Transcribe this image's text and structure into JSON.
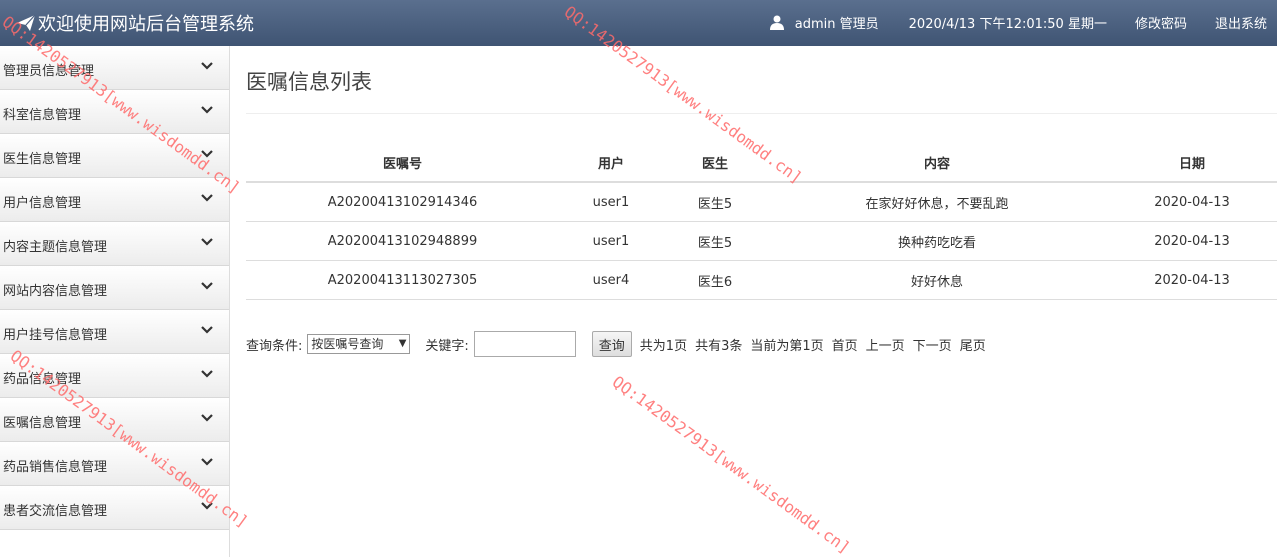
{
  "header": {
    "title": "欢迎使用网站后台管理系统",
    "user": "admin 管理员",
    "datetime": "2020/4/13 下午12:01:50 星期一",
    "change_password": "修改密码",
    "logout": "退出系统"
  },
  "sidebar": {
    "items": [
      {
        "label": "管理员信息管理"
      },
      {
        "label": "科室信息管理"
      },
      {
        "label": "医生信息管理"
      },
      {
        "label": "用户信息管理"
      },
      {
        "label": "内容主题信息管理"
      },
      {
        "label": "网站内容信息管理"
      },
      {
        "label": "用户挂号信息管理"
      },
      {
        "label": "药品信息管理"
      },
      {
        "label": "医嘱信息管理"
      },
      {
        "label": "药品销售信息管理"
      },
      {
        "label": "患者交流信息管理"
      }
    ]
  },
  "main": {
    "title": "医嘱信息列表",
    "table": {
      "headers": [
        "医嘱号",
        "用户",
        "医生",
        "内容",
        "日期"
      ],
      "rows": [
        [
          "A20200413102914346",
          "user1",
          "医生5",
          "在家好好休息，不要乱跑",
          "2020-04-13"
        ],
        [
          "A20200413102948899",
          "user1",
          "医生5",
          "换种药吃吃看",
          "2020-04-13"
        ],
        [
          "A20200413113027305",
          "user4",
          "医生6",
          "好好休息",
          "2020-04-13"
        ]
      ]
    },
    "query": {
      "condition_label": "查询条件:",
      "select_value": "按医嘱号查询",
      "keyword_label": "关键字:",
      "keyword_value": "",
      "button": "查询",
      "total_pages": "共为1页",
      "total_records": "共有3条",
      "current_page": "当前为第1页",
      "first": "首页",
      "prev": "上一页",
      "next": "下一页",
      "last": "尾页"
    }
  },
  "watermark": "QQ:1420527913[www.wisdomdd.cn]",
  "colors": {
    "header_bg": "#4b6080",
    "watermark": "#ff6b6b"
  },
  "icons": [
    "paper-plane-icon",
    "user-icon",
    "chevron-down-icon"
  ]
}
